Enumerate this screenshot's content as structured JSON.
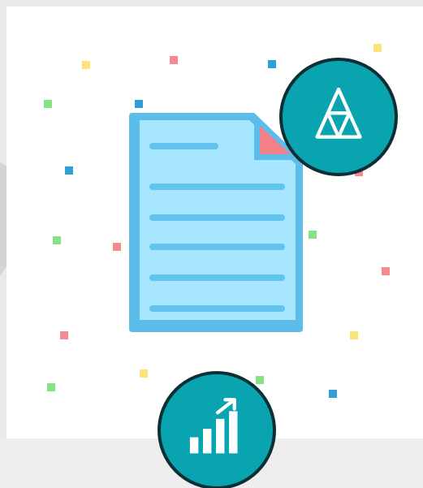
{
  "colors": {
    "page_background": "#e9e9e9",
    "card_background": "#ffffff",
    "document_fill": "#a6e7ff",
    "document_border": "#5cbdea",
    "document_lines": "#62c3ef",
    "document_fold": "#f37f87",
    "badge_fill": "#0aa3b0",
    "badge_border": "#0c2f34",
    "confetti_yellow": "#fbe27a",
    "confetti_red": "#f58a92",
    "confetti_green": "#86e287",
    "confetti_blue": "#2f9fd8"
  },
  "icons": {
    "document": "document-icon",
    "top_badge": "triangle-grid-icon",
    "bottom_badge": "bar-chart-growth-icon"
  }
}
